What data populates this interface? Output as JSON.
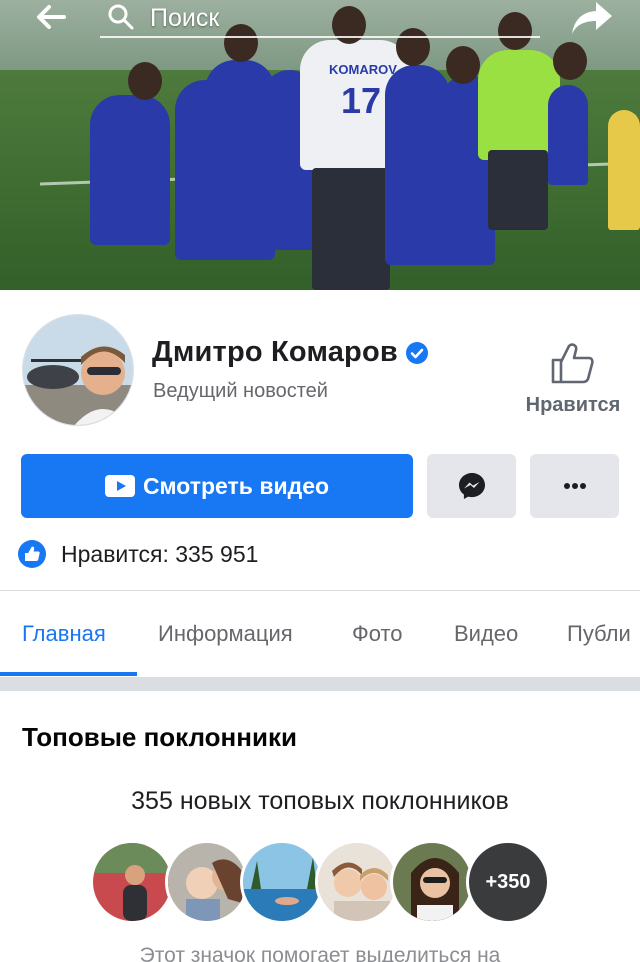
{
  "topbar": {
    "search_placeholder": "Поиск",
    "icons": {
      "back": "arrow-left-icon",
      "search": "search-icon",
      "share": "share-arrow-icon"
    }
  },
  "cover": {
    "jersey_name": "KOMAROV",
    "jersey_number": "17"
  },
  "profile": {
    "name": "Дмитро Комаров",
    "verified": true,
    "category": "Ведущий новостей",
    "like_label": "Нравится"
  },
  "actions": {
    "watch_video": "Смотреть видео",
    "messenger_icon": "messenger-icon",
    "more_icon": "more-dots-icon"
  },
  "likes": {
    "text": "Нравится: 335 951"
  },
  "tabs": [
    {
      "label": "Главная",
      "active": true
    },
    {
      "label": "Информация",
      "active": false
    },
    {
      "label": "Фото",
      "active": false
    },
    {
      "label": "Видео",
      "active": false
    },
    {
      "label": "Публи",
      "active": false
    }
  ],
  "top_fans": {
    "title": "Топовые поклонники",
    "subtitle": "355 новых топовых поклонников",
    "more_count": "+350",
    "footer": "Этот значок помогает выделиться на"
  },
  "colors": {
    "accent": "#1877f2",
    "muted": "#65676b",
    "button_gray": "#e4e6eb"
  }
}
